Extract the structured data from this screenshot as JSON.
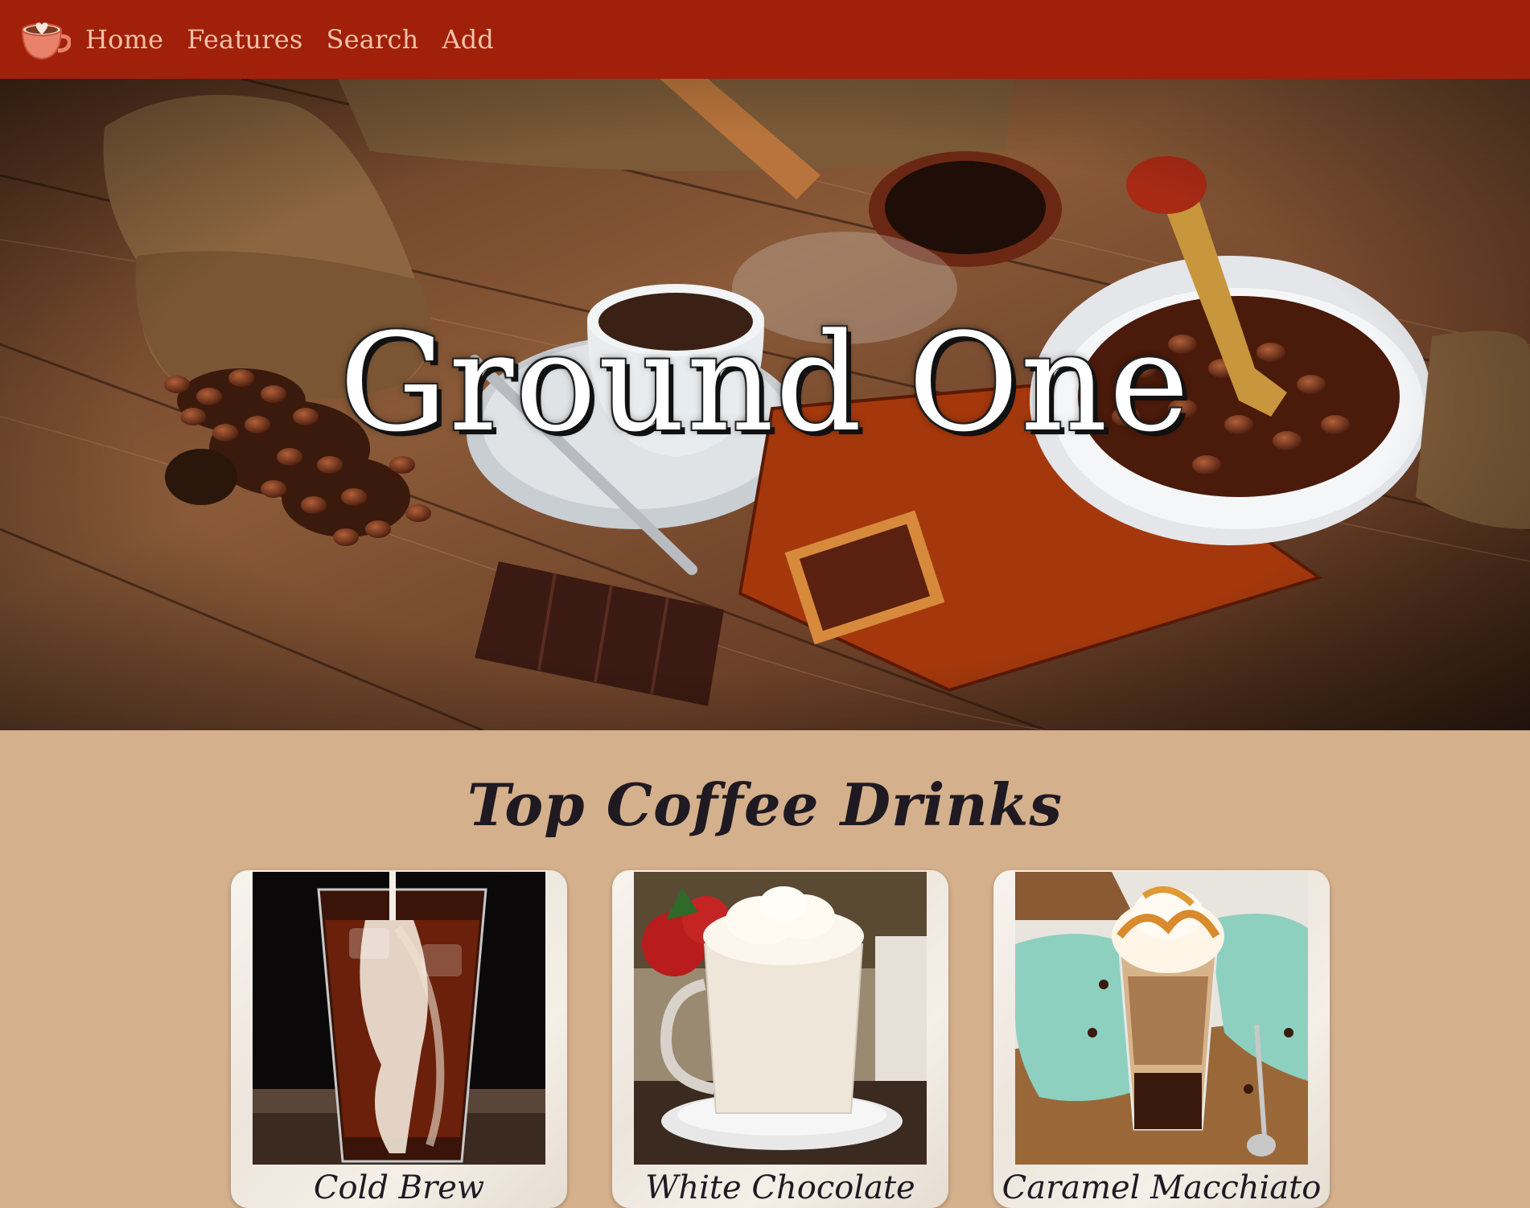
{
  "nav": {
    "logo_icon": "coffee-cup-heart-icon",
    "links": [
      {
        "label": "Home"
      },
      {
        "label": "Features"
      },
      {
        "label": "Search"
      },
      {
        "label": "Add"
      }
    ]
  },
  "hero": {
    "title": "Ground One"
  },
  "section": {
    "title": "Top Coffee Drinks"
  },
  "cards": [
    {
      "label": "Cold Brew"
    },
    {
      "label": "White Chocolate"
    },
    {
      "label": "Caramel Macchiato"
    }
  ],
  "colors": {
    "navbar": "#a0200a",
    "nav_link": "#f2c2a8",
    "page_bg": "#d4b08c",
    "heading": "#1f1a22"
  }
}
